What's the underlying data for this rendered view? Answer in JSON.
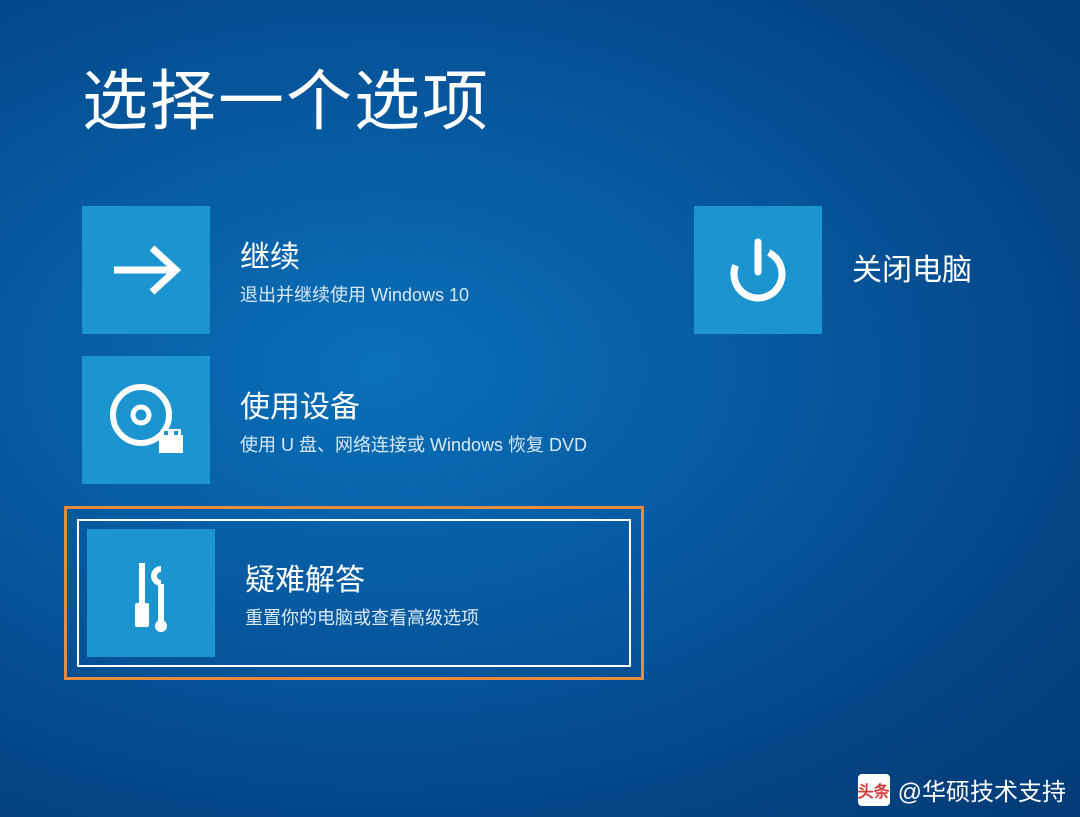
{
  "screen": {
    "title": "选择一个选项"
  },
  "options": {
    "continue": {
      "title": "继续",
      "desc": "退出并继续使用 Windows 10"
    },
    "use_device": {
      "title": "使用设备",
      "desc": "使用 U 盘、网络连接或 Windows 恢复 DVD"
    },
    "troubleshoot": {
      "title": "疑难解答",
      "desc": "重置你的电脑或查看高级选项"
    },
    "shutdown": {
      "title": "关闭电脑"
    }
  },
  "watermark": {
    "logo_text": "头条",
    "handle": "@华硕技术支持"
  }
}
